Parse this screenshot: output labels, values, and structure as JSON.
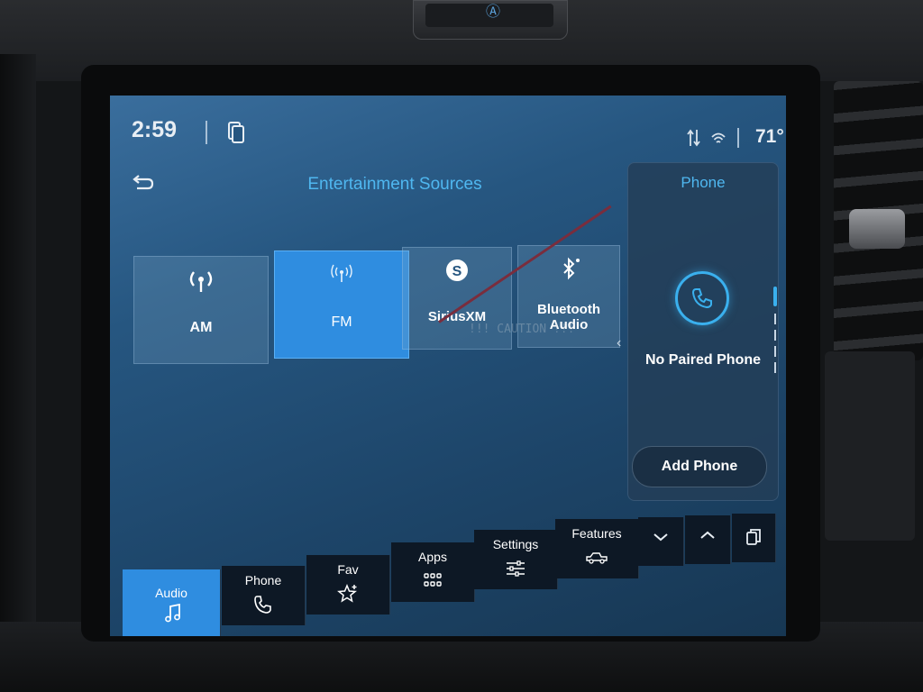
{
  "status_bar": {
    "time": "2:59",
    "temperature": "71°",
    "icons": [
      "phone-projection-icon",
      "signal-icon",
      "wifi-icon"
    ]
  },
  "header": {
    "title": "Entertainment Sources",
    "back_icon": "back-arrow-icon"
  },
  "sources": [
    {
      "label": "AM",
      "icon": "antenna-icon",
      "selected": false
    },
    {
      "label": "FM",
      "icon": "radio-waves-icon",
      "selected": true
    },
    {
      "label": "SiriusXM",
      "icon": "siriusxm-icon",
      "selected": false
    },
    {
      "label": "Bluetooth Audio",
      "icon": "bluetooth-icon",
      "selected": false
    }
  ],
  "overlay_text": "!!! CAUTION !!!",
  "phone_panel": {
    "title": "Phone",
    "status": "No Paired Phone",
    "add_button": "Add Phone",
    "icon": "phone-icon"
  },
  "nav": {
    "items": [
      {
        "label": "Audio",
        "icon": "music-note-icon",
        "active": true
      },
      {
        "label": "Phone",
        "icon": "phone-icon",
        "active": false
      },
      {
        "label": "Fav",
        "icon": "star-plus-icon",
        "active": false
      },
      {
        "label": "Apps",
        "icon": "grid-icon",
        "active": false
      },
      {
        "label": "Settings",
        "icon": "sliders-icon",
        "active": false
      },
      {
        "label": "Features",
        "icon": "truck-icon",
        "active": false
      }
    ],
    "controls": [
      "chevron-down-icon",
      "chevron-up-icon",
      "pages-icon"
    ]
  },
  "colors": {
    "accent": "#2f8de0",
    "title_blue": "#4fb7f0",
    "nav_bg": "#0d1825",
    "screen_bg": "#265680"
  }
}
